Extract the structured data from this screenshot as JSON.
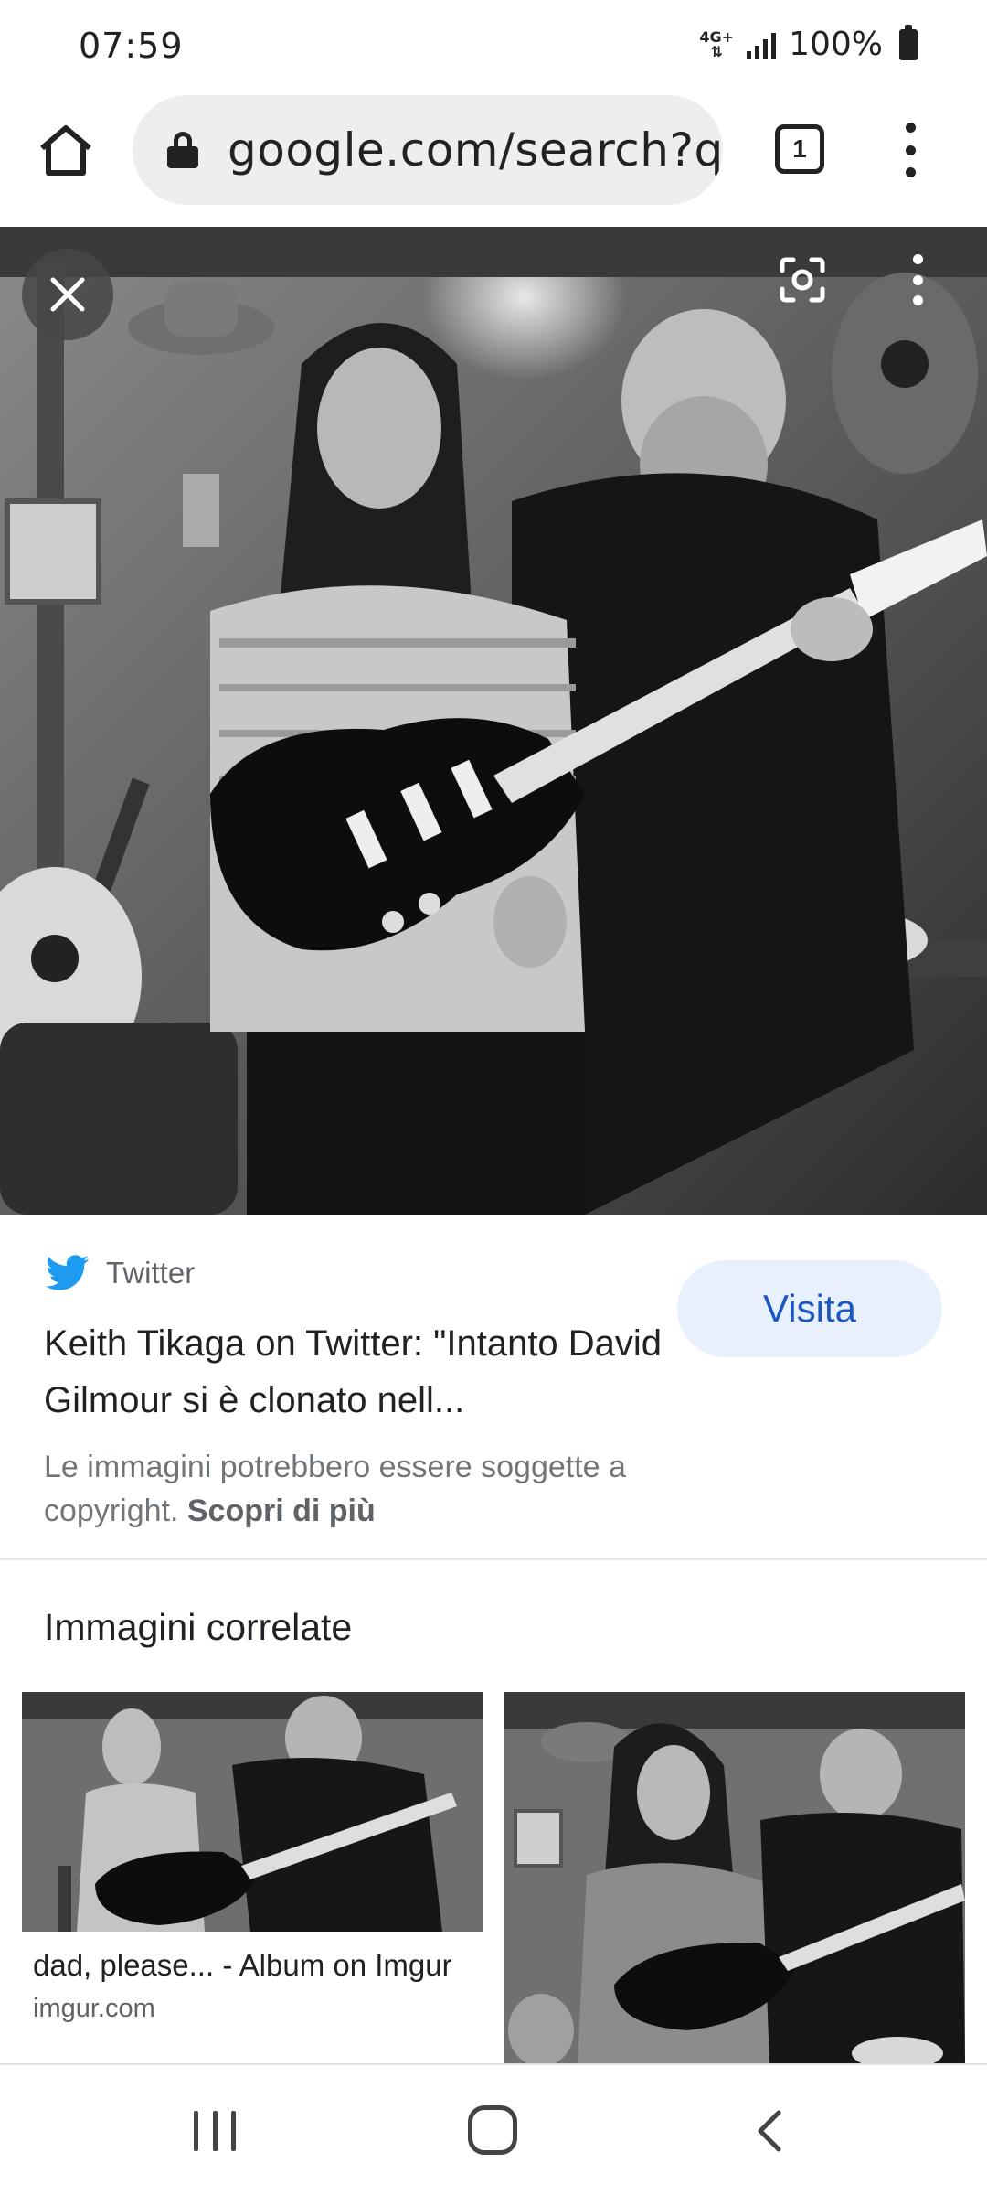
{
  "status_bar": {
    "time": "07:59",
    "network_top": "4G+",
    "network_bottom": "⇅",
    "battery": "100%"
  },
  "browser": {
    "url": "google.com/search?q=",
    "tab_count": "1",
    "icons": [
      "home-icon",
      "lock-icon",
      "tabs-icon",
      "more-vert-icon"
    ]
  },
  "image_viewer": {
    "icons": [
      "close-icon",
      "lens-icon",
      "more-vert-icon"
    ]
  },
  "result": {
    "source": "Twitter",
    "title": "Keith Tikaga on Twitter: \"Intanto David Gilmour si è clonato nell...",
    "visit_label": "Visita",
    "copyright_text": "Le immagini potrebbero essere soggette a copyright.",
    "learn_more": "Scopri di più"
  },
  "related": {
    "heading": "Immagini correlate",
    "items": [
      {
        "title": "dad, please... - Album on Imgur",
        "domain": "imgur.com"
      },
      {
        "title": "",
        "domain": ""
      }
    ]
  },
  "colors": {
    "visit_button_bg": "#e8f0fe",
    "visit_button_text": "#1a57c2",
    "twitter_blue": "#1d9bf0",
    "url_bar_bg": "#eceef0"
  }
}
